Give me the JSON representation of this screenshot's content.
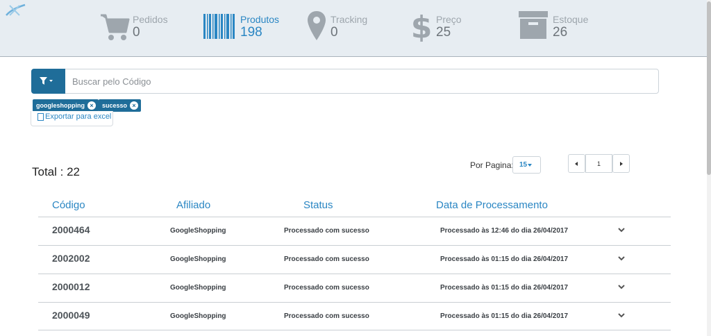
{
  "header": {
    "stats": [
      {
        "label": "Pedidos",
        "value": "0",
        "icon": "cart-icon"
      },
      {
        "label": "Produtos",
        "value": "198",
        "icon": "barcode-icon"
      },
      {
        "label": "Tracking",
        "value": "0",
        "icon": "map-pin-icon"
      },
      {
        "label": "Preço",
        "value": "25",
        "icon": "dollar-icon"
      },
      {
        "label": "Estoque",
        "value": "26",
        "icon": "archive-box-icon"
      }
    ],
    "active_stat": "Produtos"
  },
  "search": {
    "placeholder": "Buscar pelo Código",
    "value": ""
  },
  "filters": {
    "tags": [
      "googleshopping",
      "sucesso"
    ],
    "export_label": "Exportar para excel"
  },
  "summary": {
    "total_label": "Total : 22"
  },
  "pagination": {
    "per_page_label": "Por Pagina:",
    "per_page_value": "15",
    "current_page": "1"
  },
  "table": {
    "headers": [
      "Código",
      "Afiliado",
      "Status",
      "Data de Processamento"
    ],
    "rows": [
      {
        "code": "2000464",
        "affiliate": "GoogleShopping",
        "status": "Processado com sucesso",
        "date": "Processado às 12:46 do dia 26/04/2017"
      },
      {
        "code": "2002002",
        "affiliate": "GoogleShopping",
        "status": "Processado com sucesso",
        "date": "Processado às 01:15 do dia 26/04/2017"
      },
      {
        "code": "2000012",
        "affiliate": "GoogleShopping",
        "status": "Processado com sucesso",
        "date": "Processado às 01:15 do dia 26/04/2017"
      },
      {
        "code": "2000049",
        "affiliate": "GoogleShopping",
        "status": "Processado com sucesso",
        "date": "Processado às 01:15 do dia 26/04/2017"
      }
    ]
  },
  "colors": {
    "accent": "#2a86c3",
    "dark_accent": "#1f6d99",
    "header_bg": "#e7edf2",
    "icon_gray": "#9ea6ad"
  }
}
